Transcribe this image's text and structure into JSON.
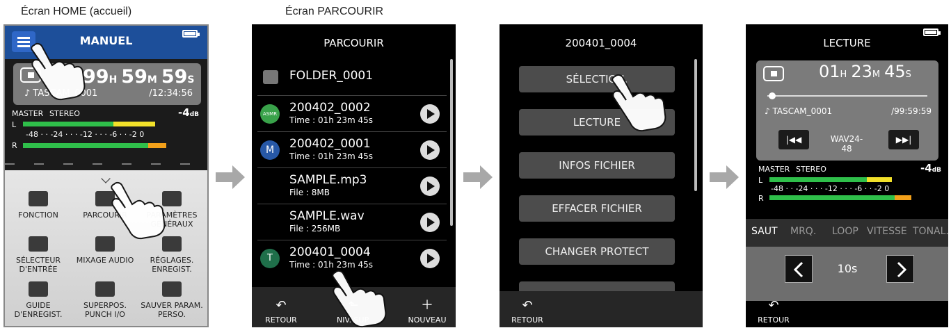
{
  "captions": {
    "home": "Écran HOME (accueil)",
    "browse": "Écran PARCOURIR"
  },
  "home": {
    "title": "MANUEL",
    "time_h": "99",
    "time_m": "59",
    "time_s": "59",
    "unit_h": "H",
    "unit_m": "M",
    "unit_s": "S",
    "filename": "♪ TASCAM_0001",
    "total": "/12:34:56",
    "master": "MASTER",
    "stereo": "STEREO",
    "db": "-4",
    "db_unit": "dB",
    "ch_l": "L",
    "ch_r": "R",
    "scale": "-48  ·  ·  -24  ·  ·  ·  -12  ·  ·  ·  -6  ·  ·  -2 0",
    "items": [
      {
        "label": "FONCTION",
        "icon": "grid-icon"
      },
      {
        "label": "PARCOURIR",
        "icon": "folder-music-icon"
      },
      {
        "label": "PARAMÈTRES GÉNÉRAUX",
        "icon": "list-icon"
      },
      {
        "label": "SÉLECTEUR D'ENTRÉE",
        "icon": "input-selector-icon"
      },
      {
        "label": "MIXAGE AUDIO",
        "icon": "mixer-icon"
      },
      {
        "label": "RÉGLAGES. ENREGIST.",
        "icon": "rec-settings-icon"
      },
      {
        "label": "GUIDE D'ENREGIST.",
        "icon": "guide-icon"
      },
      {
        "label": "SUPERPOS. PUNCH I/O",
        "icon": "punch-icon"
      },
      {
        "label": "SAUVER PARAM. PERSO.",
        "icon": "save-icon"
      }
    ]
  },
  "browse": {
    "title": "PARCOURIR",
    "files": [
      {
        "name": "FOLDER_0001",
        "sub": "",
        "avatar": "folder"
      },
      {
        "name": "200402_0002",
        "sub": "Time : 01h 23m 45s",
        "avatar": "ASMR",
        "color": "#39a24a"
      },
      {
        "name": "200402_0001",
        "sub": "Time : 01h 23m 45s",
        "avatar": "M",
        "color": "#2758a6"
      },
      {
        "name": "SAMPLE.mp3",
        "sub": "File : 8MB",
        "avatar": ""
      },
      {
        "name": "SAMPLE.wav",
        "sub": "File : 256MB",
        "avatar": ""
      },
      {
        "name": "200401_0004",
        "sub": "Time : 01h 23m 45s",
        "avatar": "T",
        "color": "#1f6f4a"
      }
    ],
    "back": "RETOUR",
    "up": "NIV. SUP.",
    "new": "NOUVEAU"
  },
  "filemenu": {
    "title": "200401_0004",
    "buttons": [
      "SÉLECTION.",
      "LECTURE",
      "INFOS FICHIER",
      "EFFACER FICHIER",
      "CHANGER PROTECT"
    ],
    "back": "RETOUR"
  },
  "playback": {
    "title": "LECTURE",
    "h": "01",
    "m": "23",
    "s": "45",
    "unit_h": "H",
    "unit_m": "M",
    "unit_s": "S",
    "filename": "♪ TASCAM_0001",
    "total": "/99:59:59",
    "format": "WAV24-48",
    "master": "MASTER",
    "stereo": "STEREO",
    "db": "-4",
    "db_unit": "dB",
    "ch_l": "L",
    "ch_r": "R",
    "scale": "-48  ·  ·  -24  ·  ·  ·  -12  ·  ·  ·  -6  ·  ·  -2 0",
    "tabs": [
      "SAUT",
      "MRQ.",
      "LOOP",
      "VITESSE",
      "TONAL."
    ],
    "skip": "10s",
    "back": "RETOUR",
    "progress": 0.03
  },
  "colors": {
    "blue": "#1d4f9a",
    "meter_green": "#2fbf4a",
    "meter_yellow": "#f2e12a",
    "meter_orange": "#f2a01a"
  }
}
